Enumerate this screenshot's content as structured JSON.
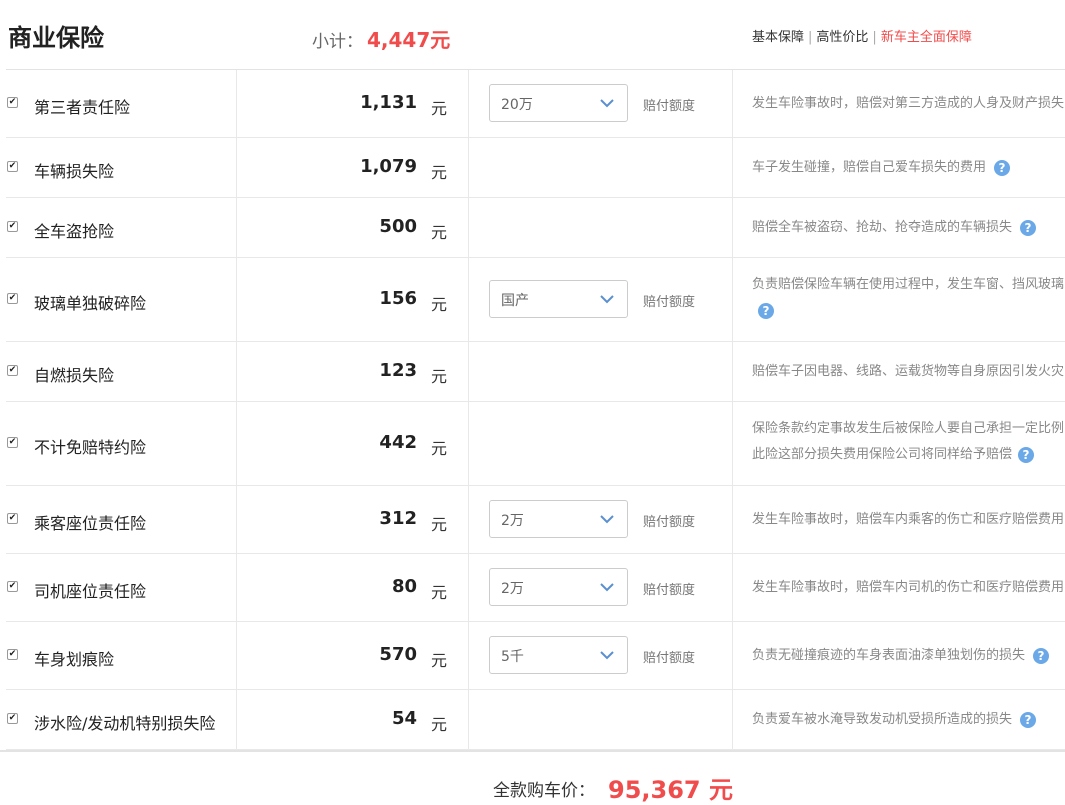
{
  "header": {
    "title": "商业保险",
    "subtotal_label": "小计：",
    "subtotal_value": "4,447元",
    "tabs": [
      "基本保障",
      "高性价比",
      "新车主全面保障"
    ]
  },
  "unit": "元",
  "coverage_label": "赔付额度",
  "items": [
    {
      "name": "第三者责任险",
      "price": "1,131",
      "select": "20万",
      "desc": "发生车险事故时，赔偿对第三方造成的人身及财产损失",
      "help": false
    },
    {
      "name": "车辆损失险",
      "price": "1,079",
      "select": null,
      "desc": "车子发生碰撞，赔偿自己爱车损失的费用",
      "help": true
    },
    {
      "name": "全车盗抢险",
      "price": "500",
      "select": null,
      "desc": "赔偿全车被盗窃、抢劫、抢夺造成的车辆损失",
      "help": true
    },
    {
      "name": "玻璃单独破碎险",
      "price": "156",
      "select": "国产",
      "desc": "负责赔偿保险车辆在使用过程中，发生车窗、挡风玻璃",
      "help": true
    },
    {
      "name": "自燃损失险",
      "price": "123",
      "select": null,
      "desc": "赔偿车子因电器、线路、运载货物等自身原因引发火灾",
      "help": false
    },
    {
      "name": "不计免赔特约险",
      "price": "442",
      "select": null,
      "desc": "保险条款约定事故发生后被保险人要自己承担一定比例",
      "desc2": "此险这部分损失费用保险公司将同样给予赔偿",
      "help": true
    },
    {
      "name": "乘客座位责任险",
      "price": "312",
      "select": "2万",
      "desc": "发生车险事故时，赔偿车内乘客的伤亡和医疗赔偿费用",
      "help": false
    },
    {
      "name": "司机座位责任险",
      "price": "80",
      "select": "2万",
      "desc": "发生车险事故时，赔偿车内司机的伤亡和医疗赔偿费用",
      "help": false
    },
    {
      "name": "车身划痕险",
      "price": "570",
      "select": "5千",
      "desc": "负责无碰撞痕迹的车身表面油漆单独划伤的损失",
      "help": true
    },
    {
      "name": "涉水险/发动机特别损失险",
      "price": "54",
      "select": null,
      "desc": "负责爱车被水淹导致发动机受损所造成的损失",
      "help": true
    }
  ],
  "footer": {
    "total_label": "全款购车价：",
    "total_value": "95,367 元"
  },
  "colors": {
    "accent": "#f04c4c",
    "help": "#6aa8e8"
  },
  "icons": {
    "checkbox": "checkbox-checked-icon",
    "dropdown": "chevron-down-icon",
    "help": "question-icon"
  }
}
